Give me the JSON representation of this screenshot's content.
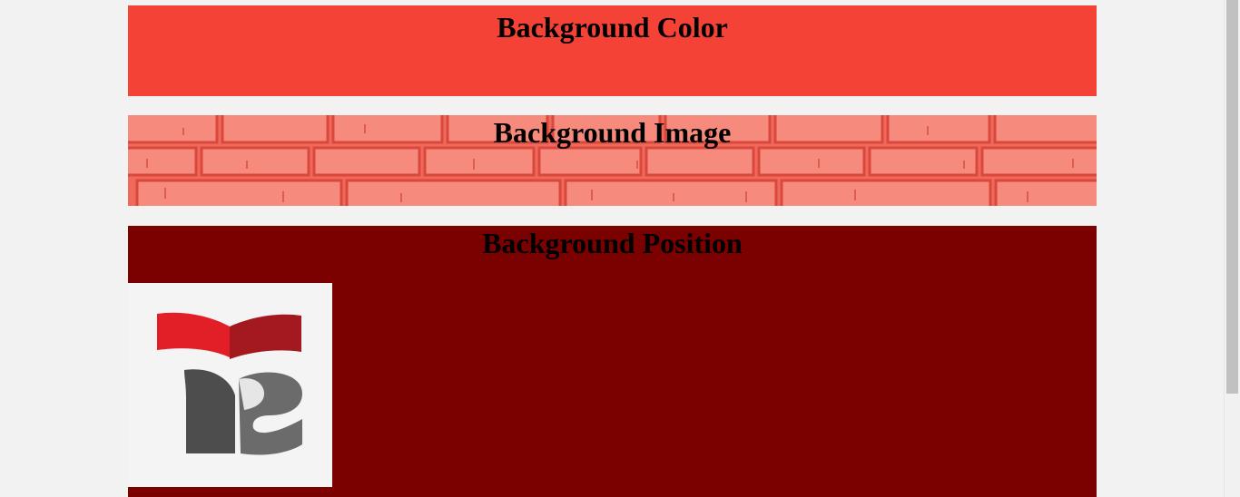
{
  "sections": {
    "color": {
      "heading": "Background Color",
      "bg": "#f44336"
    },
    "image": {
      "heading": "Background Image",
      "bg": "#ef6a5c"
    },
    "position": {
      "heading": "Background Position",
      "bg": "#7b0000"
    }
  },
  "logo": {
    "icon": "ts-book-logo-icon",
    "red": "#e21f26",
    "dark_red": "#a3191f",
    "gray": "#4d4d4d"
  }
}
